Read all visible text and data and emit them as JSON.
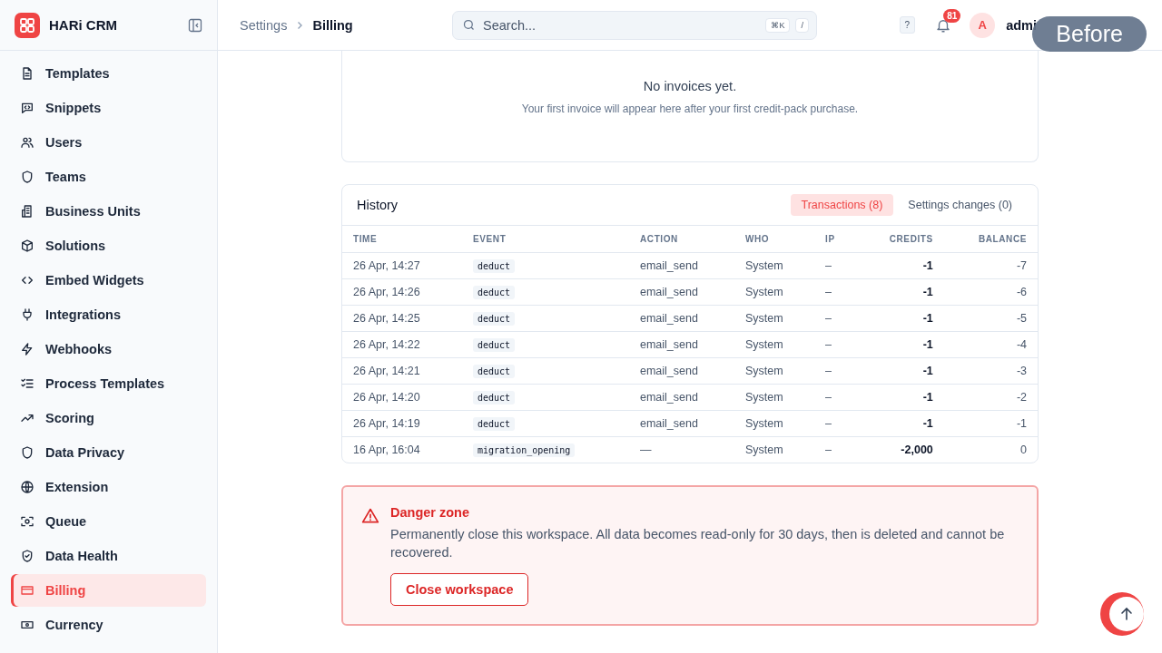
{
  "app": {
    "name": "HARi CRM"
  },
  "sidebar": {
    "items": [
      {
        "label": "Templates",
        "selected": false
      },
      {
        "label": "Snippets",
        "selected": false
      },
      {
        "label": "Users",
        "selected": false
      },
      {
        "label": "Teams",
        "selected": false
      },
      {
        "label": "Business Units",
        "selected": false
      },
      {
        "label": "Solutions",
        "selected": false
      },
      {
        "label": "Embed Widgets",
        "selected": false
      },
      {
        "label": "Integrations",
        "selected": false
      },
      {
        "label": "Webhooks",
        "selected": false
      },
      {
        "label": "Process Templates",
        "selected": false
      },
      {
        "label": "Scoring",
        "selected": false
      },
      {
        "label": "Data Privacy",
        "selected": false
      },
      {
        "label": "Extension",
        "selected": false
      },
      {
        "label": "Queue",
        "selected": false
      },
      {
        "label": "Data Health",
        "selected": false
      },
      {
        "label": "Billing",
        "selected": true
      },
      {
        "label": "Currency",
        "selected": false
      }
    ]
  },
  "breadcrumb": [
    "Settings",
    "Billing"
  ],
  "search": {
    "placeholder": "Search...",
    "shortcut_keys": [
      "⌘K",
      "/"
    ]
  },
  "help_key": "?",
  "notifications": {
    "count": "81"
  },
  "user": {
    "initial": "A",
    "email": "admi"
  },
  "overlay_label": "Before",
  "invoices": {
    "empty_title": "No invoices yet.",
    "empty_text": "Your first invoice will appear here after your first credit-pack purchase."
  },
  "history": {
    "title": "History",
    "tabs": [
      {
        "label": "Transactions (8)",
        "selected": true
      },
      {
        "label": "Settings changes (0)",
        "selected": false
      }
    ],
    "columns": [
      "TIME",
      "EVENT",
      "ACTION",
      "WHO",
      "IP",
      "CREDITS",
      "BALANCE"
    ],
    "rows": [
      [
        "26 Apr, 14:27",
        "deduct",
        "email_send",
        "System",
        "–",
        "-1",
        "-7"
      ],
      [
        "26 Apr, 14:26",
        "deduct",
        "email_send",
        "System",
        "–",
        "-1",
        "-6"
      ],
      [
        "26 Apr, 14:25",
        "deduct",
        "email_send",
        "System",
        "–",
        "-1",
        "-5"
      ],
      [
        "26 Apr, 14:22",
        "deduct",
        "email_send",
        "System",
        "–",
        "-1",
        "-4"
      ],
      [
        "26 Apr, 14:21",
        "deduct",
        "email_send",
        "System",
        "–",
        "-1",
        "-3"
      ],
      [
        "26 Apr, 14:20",
        "deduct",
        "email_send",
        "System",
        "–",
        "-1",
        "-2"
      ],
      [
        "26 Apr, 14:19",
        "deduct",
        "email_send",
        "System",
        "–",
        "-1",
        "-1"
      ],
      [
        "16 Apr, 16:04",
        "migration_opening",
        "—",
        "System",
        "–",
        "-2,000",
        "0"
      ]
    ]
  },
  "danger_zone": {
    "title": "Danger zone",
    "text": "Permanently close this workspace. All data becomes read-only for 30 days, then is deleted and cannot be recovered.",
    "button": "Close workspace"
  }
}
